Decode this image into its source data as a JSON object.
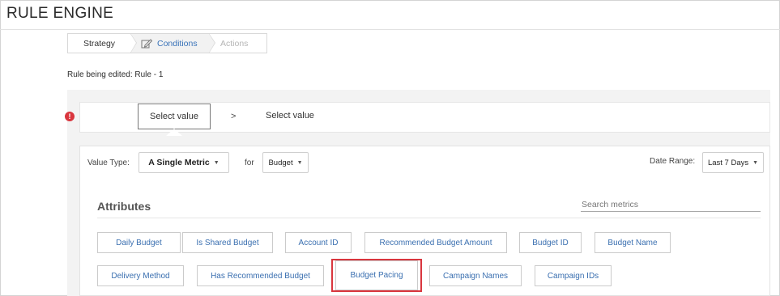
{
  "app": {
    "title": "RULE ENGINE"
  },
  "stepper": {
    "steps": [
      {
        "label": "Strategy",
        "state": "done"
      },
      {
        "label": "Conditions",
        "state": "active",
        "icon": "edit-icon"
      },
      {
        "label": "Actions",
        "state": "pending"
      }
    ]
  },
  "rule_info": {
    "text": "Rule being edited: Rule - 1"
  },
  "value_selector": {
    "first": "Select value",
    "separator": ">",
    "second": "Select value",
    "error_icon": "!"
  },
  "filters": {
    "value_type_label": "Value Type:",
    "value_type": "A Single Metric",
    "for_label": "for",
    "for_value": "Budget",
    "date_range_label": "Date Range:",
    "date_range": "Last 7 Days"
  },
  "attributes": {
    "title": "Attributes",
    "search_placeholder": "Search metrics",
    "items": [
      "Daily Budget",
      "Is Shared Budget",
      "Account ID",
      "Recommended Budget Amount",
      "Budget ID",
      "Budget Name",
      "Delivery Method",
      "Has Recommended Budget",
      "Budget Pacing",
      "Campaign Names",
      "Campaign IDs"
    ],
    "highlighted": "Budget Pacing"
  },
  "colors": {
    "link_blue": "#3a6fb0",
    "error_red": "#d9363e",
    "panel_gray": "#f3f3f3"
  }
}
